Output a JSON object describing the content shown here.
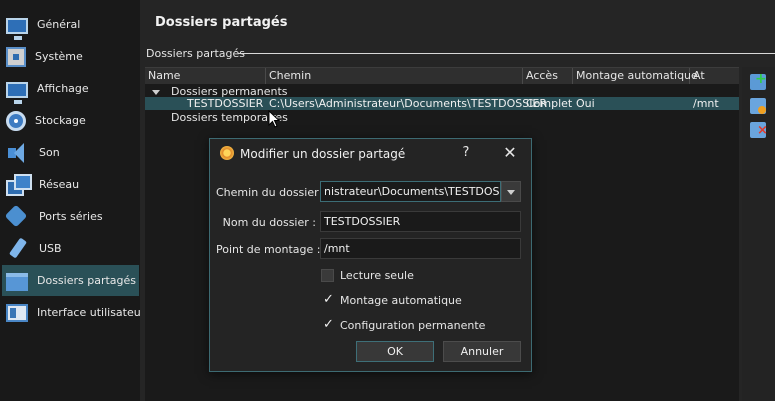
{
  "sidebar": {
    "items": [
      {
        "label": "Général",
        "icon": "monitor-icon"
      },
      {
        "label": "Système",
        "icon": "chip-icon"
      },
      {
        "label": "Affichage",
        "icon": "display-icon"
      },
      {
        "label": "Stockage",
        "icon": "disk-icon"
      },
      {
        "label": "Son",
        "icon": "speaker-icon"
      },
      {
        "label": "Réseau",
        "icon": "network-icon"
      },
      {
        "label": "Ports séries",
        "icon": "serial-port-icon"
      },
      {
        "label": "USB",
        "icon": "usb-icon"
      },
      {
        "label": "Dossiers partagés",
        "icon": "folder-icon"
      },
      {
        "label": "Interface utilisateur",
        "icon": "ui-icon"
      }
    ],
    "active": "Dossiers partagés"
  },
  "main": {
    "title": "Dossiers partagés",
    "section_label": "Dossiers partagés",
    "table": {
      "columns": [
        "Name",
        "Chemin",
        "Accès",
        "Montage automatique",
        "At"
      ],
      "groups": {
        "permanent": "Dossiers permanents",
        "temporary": "Dossiers temporaires"
      },
      "rows": [
        {
          "name": "TESTDOSSIER",
          "path": "C:\\Users\\Administrateur\\Documents\\TESTDOSSIER",
          "access": "Complet",
          "automount": "Oui",
          "at": "/mnt"
        }
      ]
    },
    "tools": [
      "add-folder-icon",
      "edit-folder-icon",
      "remove-folder-icon"
    ]
  },
  "dialog": {
    "title": "Modifier un dossier partagé",
    "help": "?",
    "close": "✕",
    "path_label": "Chemin du dossier :",
    "path_value": "nistrateur\\Documents\\TESTDOSSIER",
    "name_label": "Nom du dossier :",
    "name_value": "TESTDOSSIER",
    "mount_label": "Point de montage :",
    "mount_value": "/mnt",
    "readonly_label": "Lecture seule",
    "readonly_checked": false,
    "automount_label": "Montage automatique",
    "automount_checked": true,
    "permanent_label": "Configuration permanente",
    "permanent_checked": true,
    "check_mark": "✓",
    "ok_label": "OK",
    "cancel_label": "Annuler"
  },
  "colors": {
    "selection": "#2a5057",
    "accent_border": "#3d6a72",
    "background": "#252525"
  }
}
